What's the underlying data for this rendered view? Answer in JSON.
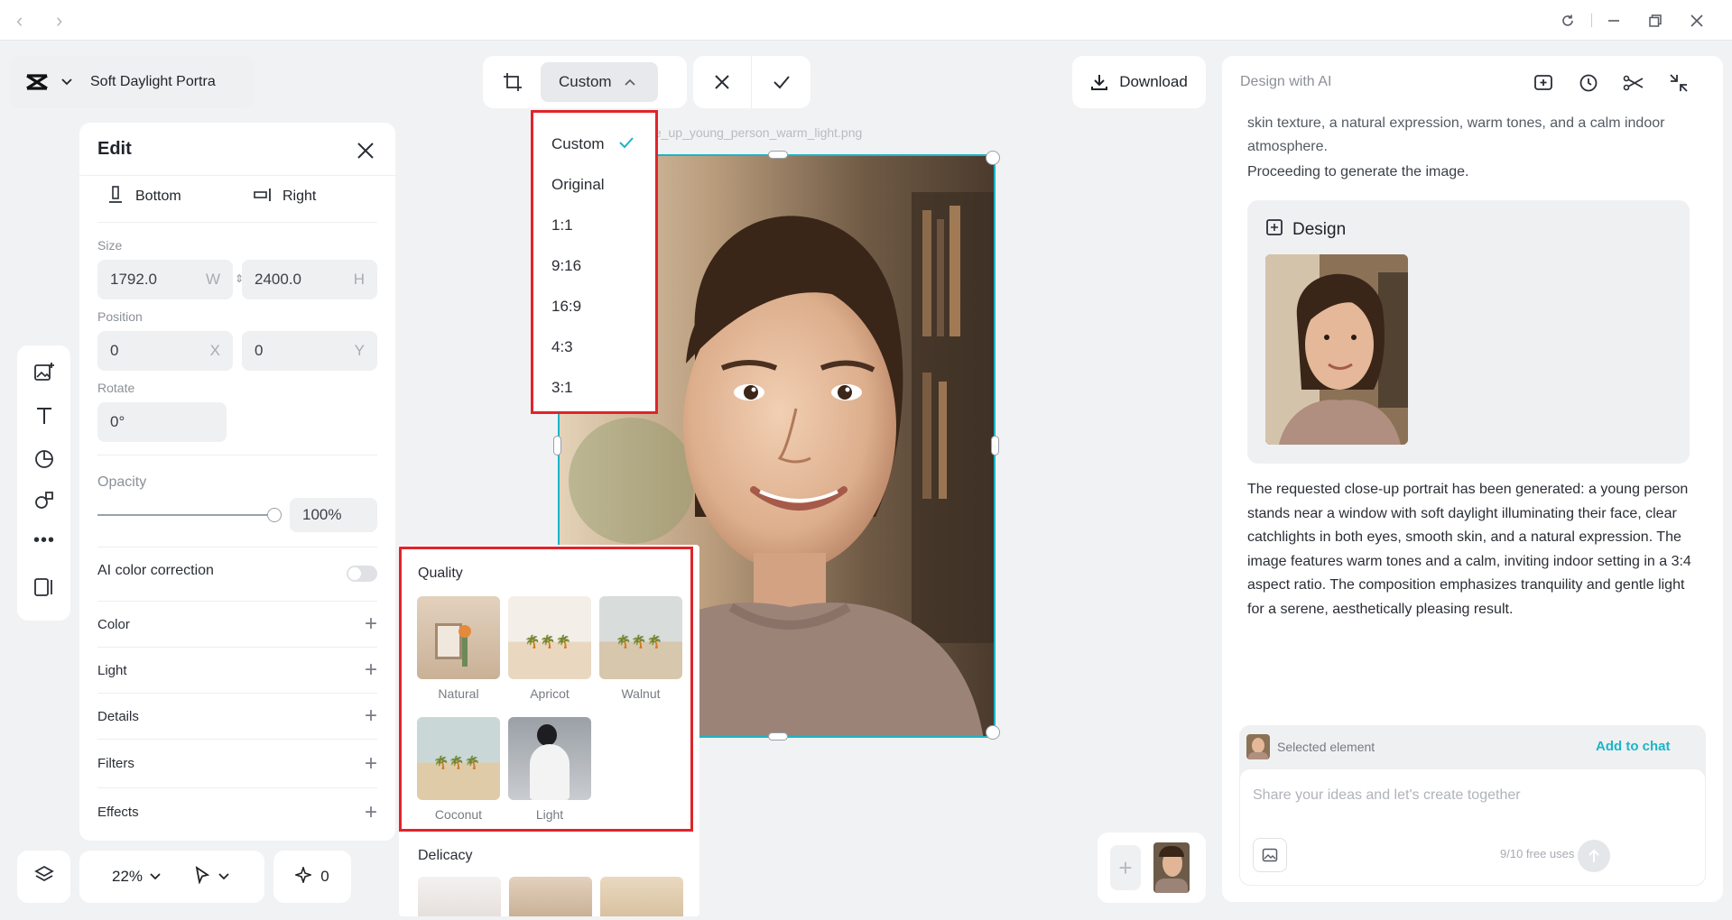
{
  "topbar": {
    "back_icon": "chevron-left-icon",
    "forward_icon": "chevron-right-icon",
    "refresh_icon": "refresh-icon",
    "minimize_icon": "minimize-icon",
    "restore_icon": "restore-icon",
    "close_icon": "close-icon"
  },
  "project": {
    "name": "Soft Daylight Portra"
  },
  "toolbar": {
    "ratio_label": "Custom",
    "download_label": "Download"
  },
  "ratio_menu": {
    "items": [
      "Custom",
      "Original",
      "1:1",
      "9:16",
      "16:9",
      "4:3",
      "3:1"
    ],
    "selected": "Custom"
  },
  "canvas": {
    "filename": "close_up_young_person_warm_light.png"
  },
  "edit_panel": {
    "title": "Edit",
    "align_bottom": "Bottom",
    "align_right": "Right",
    "size_label": "Size",
    "width": "1792.0",
    "width_suffix": "W",
    "height": "2400.0",
    "height_suffix": "H",
    "position_label": "Position",
    "pos_x": "0",
    "pos_x_suffix": "X",
    "pos_y": "0",
    "pos_y_suffix": "Y",
    "rotate_label": "Rotate",
    "rotate": "0°",
    "opacity_label": "Opacity",
    "opacity_value": "100%",
    "opacity_fraction": 1.0,
    "ai_color_label": "AI color correction",
    "ai_color_on": false,
    "sections": [
      "Color",
      "Light",
      "Details",
      "Filters",
      "Effects"
    ]
  },
  "filters_popup": {
    "quality_title": "Quality",
    "quality_items": [
      "Natural",
      "Apricot",
      "Walnut",
      "Coconut",
      "Light"
    ],
    "delicacy_title": "Delicacy"
  },
  "bottom_bar": {
    "zoom": "22%",
    "counter": "0"
  },
  "ai_panel": {
    "title": "Design with AI",
    "msg_top": "skin texture, a natural expression, warm tones, and a calm indoor atmosphere.",
    "msg_proceed": "Proceeding to generate the image.",
    "design_card_title": "Design",
    "result_text": "The requested close-up portrait has been generated: a young person stands near a window with soft daylight illuminating their face, clear catchlights in both eyes, smooth skin, and a natural expression. The image features warm tones and a calm, inviting indoor setting in a 3:4 aspect ratio. The composition emphasizes tranquility and gentle light for a serene, aesthetically pleasing result.",
    "selected_element": "Selected element",
    "add_to_chat": "Add to chat",
    "input_placeholder": "Share your ideas and let's create together",
    "free_uses": "9/10 free uses"
  },
  "colors": {
    "accent": "#1bb5c8",
    "highlight_border": "#e0242a"
  }
}
